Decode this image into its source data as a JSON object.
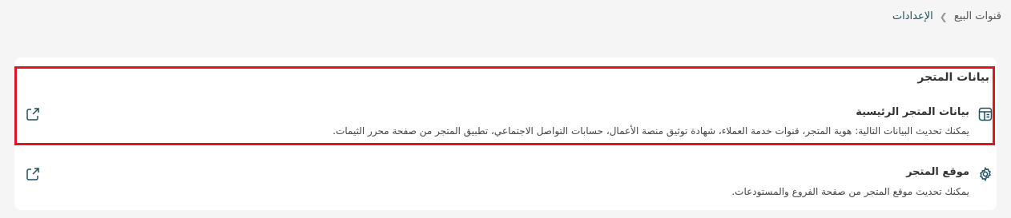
{
  "breadcrumb": {
    "root": "قنوات البيع",
    "current": "الإعدادات"
  },
  "section": {
    "title": "بيانات المتجر"
  },
  "rows": [
    {
      "title": "بيانات المتجر الرئيسية",
      "description": "يمكنك تحديث البيانات التالية: هوية المتجر، قنوات خدمة العملاء، شهادة توثيق منصة الأعمال، حسابات التواصل الاجتماعي، تطبيق المتجر من صفحة محرر الثيمات.",
      "icon": "store-info-icon"
    },
    {
      "title": "موقع المتجر",
      "description": "يمكنك تحديث موقع المتجر من صفحة الفروع والمستودعات.",
      "icon": "gear-icon"
    }
  ],
  "colors": {
    "accent": "#1d4f5c",
    "highlight": "#e0141e"
  }
}
